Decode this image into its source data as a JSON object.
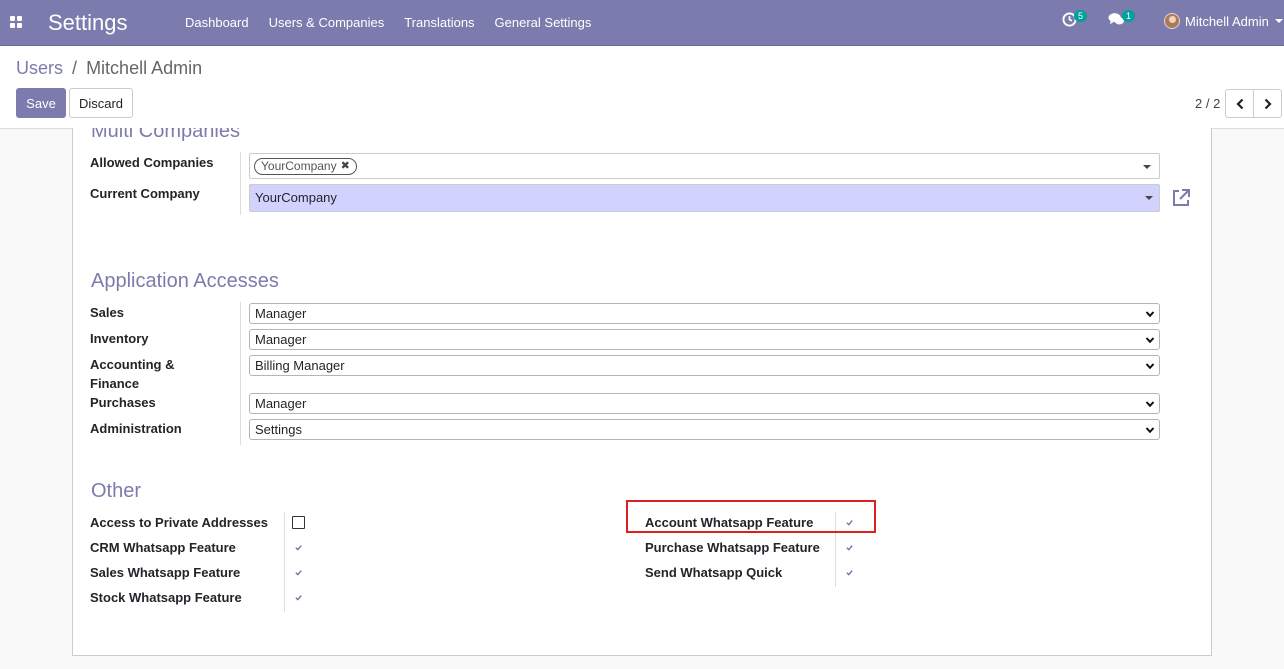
{
  "navbar": {
    "app_title": "Settings",
    "menu": [
      "Dashboard",
      "Users & Companies",
      "Translations",
      "General Settings"
    ],
    "activity_count": "5",
    "messages_count": "1",
    "user_name": "Mitchell Admin"
  },
  "breadcrumb": {
    "parent": "Users",
    "separator": "/",
    "current": "Mitchell Admin"
  },
  "buttons": {
    "save": "Save",
    "discard": "Discard"
  },
  "pager": {
    "value": "2 / 2"
  },
  "multi_companies": {
    "title": "Multi Companies",
    "allowed_label": "Allowed Companies",
    "allowed_tags": [
      "YourCompany"
    ],
    "current_label": "Current Company",
    "current_value": "YourCompany"
  },
  "app_access": {
    "title": "Application Accesses",
    "fields": [
      {
        "label": "Sales",
        "value": "Manager"
      },
      {
        "label": "Inventory",
        "value": "Manager"
      },
      {
        "label": "Accounting & Finance",
        "value": "Billing Manager"
      },
      {
        "label": "Purchases",
        "value": "Manager"
      },
      {
        "label": "Administration",
        "value": "Settings"
      }
    ]
  },
  "other": {
    "title": "Other",
    "left": [
      {
        "label": "Access to Private Addresses",
        "checked": false
      },
      {
        "label": "CRM Whatsapp Feature",
        "checked": true
      },
      {
        "label": "Sales Whatsapp Feature",
        "checked": true
      },
      {
        "label": "Stock Whatsapp Feature",
        "checked": true
      }
    ],
    "right": [
      {
        "label": "Account Whatsapp Feature",
        "checked": true
      },
      {
        "label": "Purchase Whatsapp Feature",
        "checked": true
      },
      {
        "label": "Send Whatsapp Quick",
        "checked": true
      }
    ]
  },
  "colors": {
    "brand": "#7c7bad",
    "highlight": "#e02020",
    "many2one_bg": "#d2d2ff"
  }
}
